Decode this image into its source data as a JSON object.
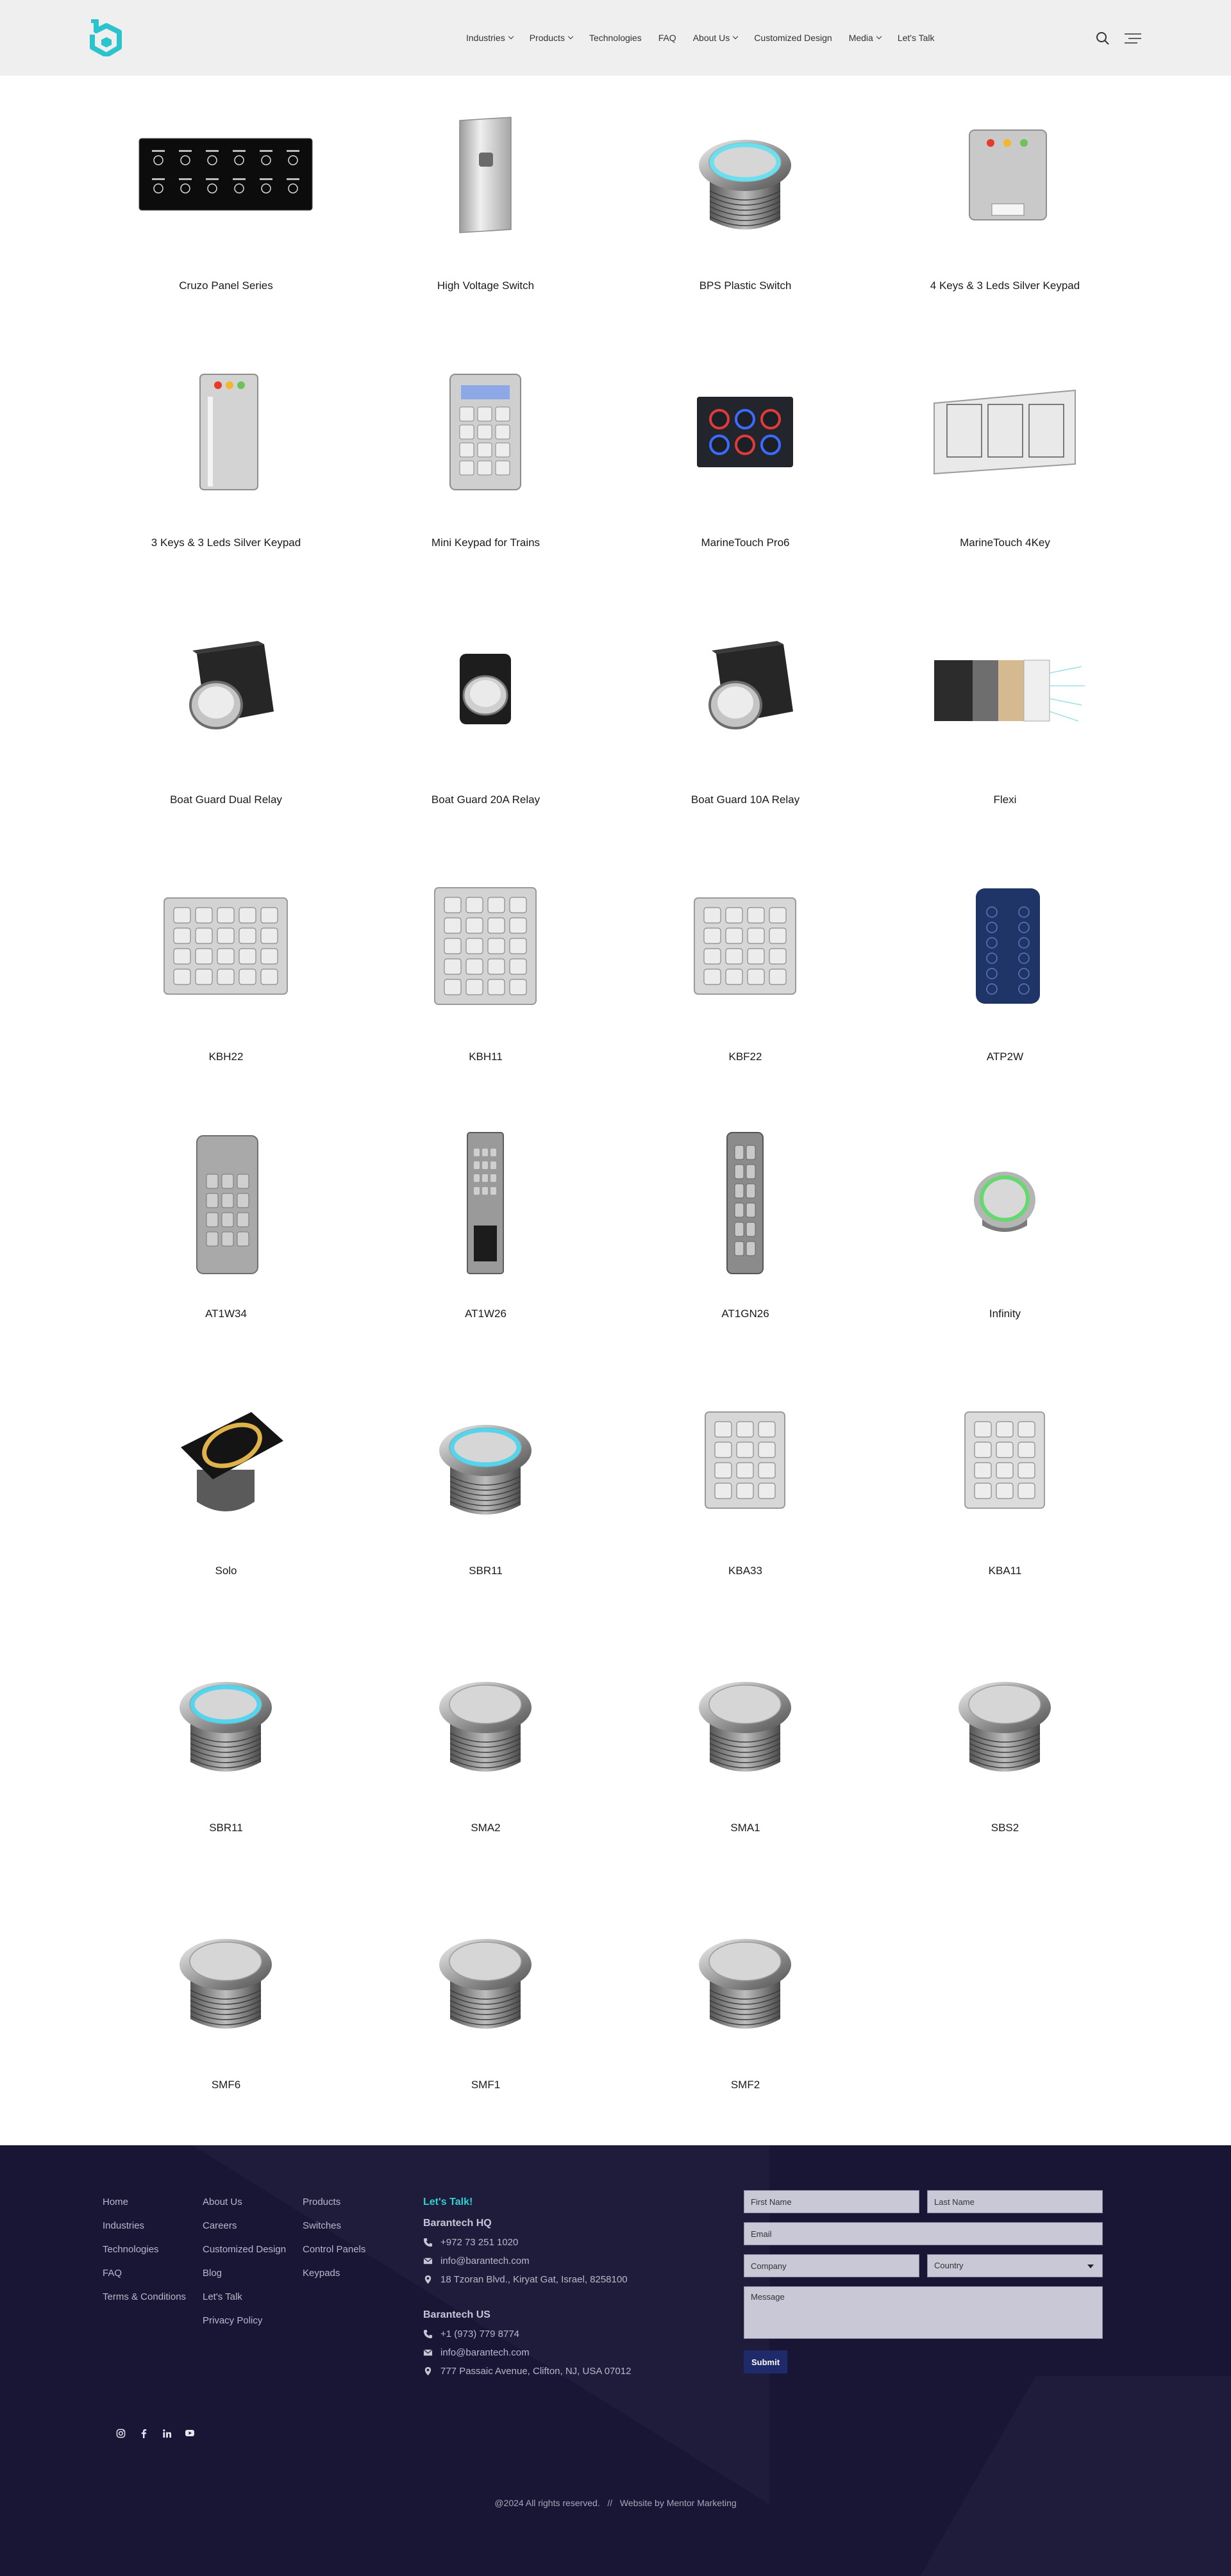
{
  "header": {
    "nav": [
      {
        "label": "Industries",
        "dropdown": true
      },
      {
        "label": "Products",
        "dropdown": true
      },
      {
        "label": "Technologies",
        "dropdown": false
      },
      {
        "label": "FAQ",
        "dropdown": false
      },
      {
        "label": "About Us",
        "dropdown": true
      },
      {
        "label": "Customized Design",
        "dropdown": false
      },
      {
        "label": "Media",
        "dropdown": true
      },
      {
        "label": "Let's Talk",
        "dropdown": false
      }
    ],
    "icons": {
      "logo": "barantech-logo",
      "search": "search-icon",
      "menu": "hamburger-menu-icon"
    },
    "accent": "#2cc4cc"
  },
  "products": [
    {
      "name": "Cruzo Panel Series",
      "icon": "black-panel"
    },
    {
      "name": "High Voltage Switch",
      "icon": "silver-plate"
    },
    {
      "name": "BPS Plastic Switch",
      "icon": "button-cyan"
    },
    {
      "name": "4 Keys & 3 Leds Silver Keypad",
      "icon": "silver-keypad-leds"
    },
    {
      "name": "3 Keys & 3 Leds Silver Keypad",
      "icon": "tall-keypad-leds"
    },
    {
      "name": "Mini Keypad for Trains",
      "icon": "mini-keypad"
    },
    {
      "name": "MarineTouch Pro6",
      "icon": "marine-pro6"
    },
    {
      "name": "MarineTouch 4Key",
      "icon": "marine-4key"
    },
    {
      "name": "Boat Guard Dual Relay",
      "icon": "relay-box"
    },
    {
      "name": "Boat Guard 20A Relay",
      "icon": "relay-small"
    },
    {
      "name": "Boat Guard 10A Relay",
      "icon": "relay-box"
    },
    {
      "name": "Flexi",
      "icon": "flexi"
    },
    {
      "name": "KBH22",
      "icon": "keypad-20"
    },
    {
      "name": "KBH11",
      "icon": "keypad-20v"
    },
    {
      "name": "KBF22",
      "icon": "keypad-16"
    },
    {
      "name": "ATP2W",
      "icon": "blue-keypad"
    },
    {
      "name": "AT1W34",
      "icon": "slim-keypad"
    },
    {
      "name": "AT1W26",
      "icon": "slim-reader"
    },
    {
      "name": "AT1GN26",
      "icon": "narrow-keypad"
    },
    {
      "name": "Infinity",
      "icon": "button-green"
    },
    {
      "name": "Solo",
      "icon": "button-square-gold"
    },
    {
      "name": "SBR11",
      "icon": "button-cyan-large"
    },
    {
      "name": "KBA33",
      "icon": "keypad-12"
    },
    {
      "name": "KBA11",
      "icon": "keypad-12s"
    },
    {
      "name": "SBR11",
      "icon": "button-cyan-large"
    },
    {
      "name": "SMA2",
      "icon": "button-steel"
    },
    {
      "name": "SMA1",
      "icon": "button-steel"
    },
    {
      "name": "SBS2",
      "icon": "button-steel"
    },
    {
      "name": "SMF6",
      "icon": "button-steel-flat"
    },
    {
      "name": "SMF1",
      "icon": "button-steel-flat"
    },
    {
      "name": "SMF2",
      "icon": "button-steel-flat"
    }
  ],
  "footer": {
    "col1": [
      "Home",
      "Industries",
      "Technologies",
      "FAQ",
      "Terms & Conditions"
    ],
    "col2": [
      "About Us",
      "Careers",
      "Customized Design",
      "Blog",
      "Let's Talk",
      "Privacy Policy"
    ],
    "col3": [
      "Products",
      "Switches",
      "Control Panels",
      "Keypads"
    ],
    "contact": {
      "title": "Let's Talk!",
      "hq_title": "Barantech HQ",
      "hq_phone": "+972 73 251 1020",
      "hq_email": "info@barantech.com",
      "hq_address": "18 Tzoran Blvd., Kiryat Gat, Israel, 8258100",
      "us_title": "Barantech US",
      "us_phone": "+1 (973) 779 8774",
      "us_email": "info@barantech.com",
      "us_address": "777 Passaic Avenue, Clifton, NJ, USA 07012"
    },
    "form": {
      "first_name": "First Name",
      "last_name": "Last Name",
      "email": "Email",
      "company": "Company",
      "country": "Country",
      "message": "Message",
      "submit": "Submit"
    },
    "socials": [
      "instagram-icon",
      "facebook-icon",
      "linkedin-icon",
      "youtube-icon"
    ],
    "copyright": "@2024 All rights reserved.   //   Website by Mentor Marketing"
  }
}
